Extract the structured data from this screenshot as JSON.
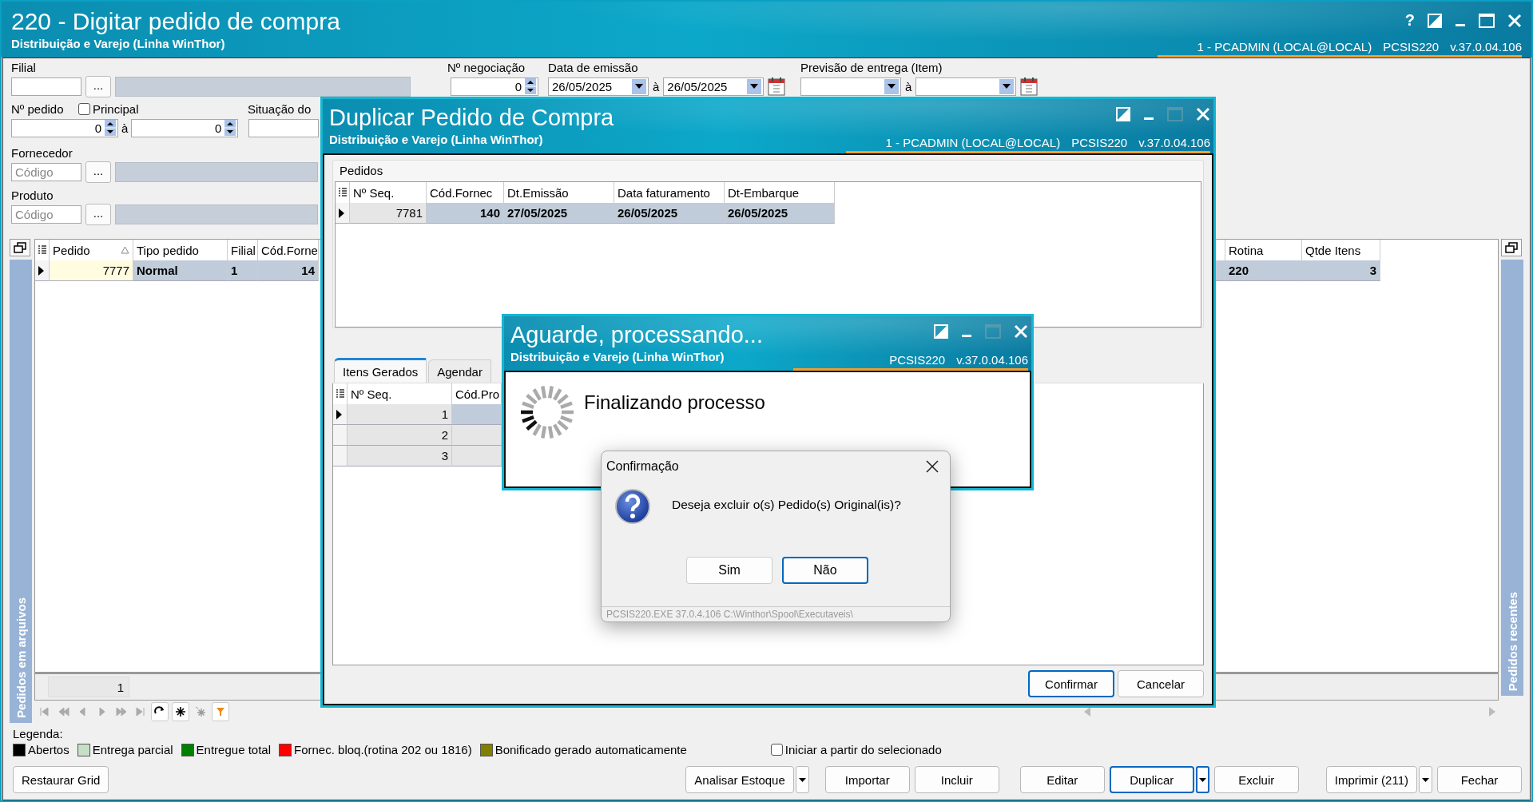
{
  "window": {
    "title": "220 - Digitar pedido de compra",
    "subtitle": "Distribuição e Varejo (Linha WinThor)",
    "help": "?",
    "session": "1 - PCADMIN (LOCAL@LOCAL)",
    "module": "PCSIS220",
    "version": "v.37.0.04.106"
  },
  "filters": {
    "filial": {
      "label": "Filial",
      "button": "..."
    },
    "negociacao": {
      "label": "Nº negociação",
      "value": "0"
    },
    "emissao": {
      "label": "Data de emissão",
      "from": "26/05/2025",
      "sep": "à",
      "to": "26/05/2025"
    },
    "previsao": {
      "label": "Previsão  de entrega (Item)",
      "sep": "à"
    },
    "pedido": {
      "label": "Nº pedido",
      "from": "0",
      "sep": "à",
      "to": "0"
    },
    "principal": {
      "label": "Principal",
      "checked": false
    },
    "situacao": {
      "label": "Situação do"
    },
    "fornecedor": {
      "label": "Fornecedor",
      "placeholder": "Código",
      "button": "..."
    },
    "produto": {
      "label": "Produto",
      "placeholder": "Código",
      "button": "..."
    }
  },
  "left_panel": "Pedidos em arquivos",
  "right_panel": "Pedidos recentes",
  "main_grid": {
    "columns": [
      {
        "label": "Pedido",
        "sorted": true
      },
      {
        "label": "Tipo pedido",
        "sorted": false
      },
      {
        "label": "Filial",
        "sorted": false
      },
      {
        "label": "Cód.Forne",
        "sorted": false
      },
      {
        "label": "Rotina",
        "sorted": false
      },
      {
        "label": "Qtde Itens",
        "sorted": false
      }
    ],
    "rows": [
      {
        "selected": true,
        "cells": [
          {
            "text": "7777",
            "focused": true
          },
          {
            "text": "Normal",
            "focused": false
          },
          {
            "text": "1",
            "focused": false
          },
          {
            "text": "14",
            "focused": false
          },
          {
            "text": "220",
            "focused": false
          },
          {
            "text": "3",
            "focused": false
          }
        ]
      }
    ],
    "count": "1"
  },
  "legend": {
    "title": "Legenda:",
    "items": [
      {
        "label": "Abertos",
        "color": "#000000"
      },
      {
        "label": "Entrega parcial",
        "color": "#c6e0c6"
      },
      {
        "label": "Entregue total",
        "color": "#008000"
      },
      {
        "label": "Fornec. bloq.(rotina 202 ou 1816)",
        "color": "#ff0000"
      },
      {
        "label": "Bonificado gerado automaticamente",
        "color": "#808000"
      }
    ]
  },
  "start_from_selected": {
    "label": "Iniciar a partir do selecionado",
    "checked": false
  },
  "buttons": [
    {
      "label": "Restaurar Grid",
      "dropdown": false,
      "focused": false
    },
    {
      "label": "Analisar Estoque",
      "dropdown": true,
      "focused": false
    },
    {
      "label": "Importar",
      "dropdown": false,
      "focused": false
    },
    {
      "label": "Incluir",
      "dropdown": false,
      "focused": false
    },
    {
      "label": "Editar",
      "dropdown": false,
      "focused": false
    },
    {
      "label": "Duplicar",
      "dropdown": true,
      "focused": true
    },
    {
      "label": "Excluir",
      "dropdown": false,
      "focused": false
    },
    {
      "label": "Imprimir (211)",
      "dropdown": true,
      "focused": false
    },
    {
      "label": "Fechar",
      "dropdown": false,
      "focused": false
    }
  ],
  "duplicate_dialog": {
    "title": "Duplicar Pedido de Compra",
    "subtitle": "Distribuição e Varejo (Linha WinThor)",
    "session": "1 - PCADMIN (LOCAL@LOCAL)",
    "module": "PCSIS220",
    "version": "v.37.0.04.106",
    "group": "Pedidos",
    "columns": [
      "Nº Seq.",
      "Cód.Fornec",
      "Dt.Emissão",
      "Data faturamento",
      "Dt-Embarque"
    ],
    "rows": [
      {
        "selected": true,
        "cells": [
          "7781",
          "140",
          "27/05/2025",
          "26/05/2025",
          "26/05/2025"
        ]
      }
    ],
    "tabs": [
      {
        "label": "Itens Gerados",
        "selected": true
      },
      {
        "label": "Agendar",
        "selected": false
      }
    ],
    "item_columns": [
      "Nº Seq.",
      "Cód.Pro"
    ],
    "item_rows": [
      {
        "selected": true,
        "cells": [
          "1"
        ]
      },
      {
        "selected": false,
        "cells": [
          "2"
        ]
      },
      {
        "selected": false,
        "cells": [
          "3"
        ]
      }
    ],
    "buttons": [
      {
        "label": "Confirmar",
        "focused": true
      },
      {
        "label": "Cancelar",
        "focused": false
      }
    ]
  },
  "progress_dialog": {
    "title": "Aguarde, processando...",
    "subtitle": "Distribuição e Varejo (Linha WinThor)",
    "module": "PCSIS220",
    "version": "v.37.0.04.106",
    "message": "Finalizando processo"
  },
  "confirm_dialog": {
    "title": "Confirmação",
    "message": "Deseja excluir o(s) Pedido(s) Original(is)?",
    "buttons": [
      {
        "label": "Sim",
        "focused": false
      },
      {
        "label": "Não",
        "focused": true
      }
    ],
    "footer": "PCSIS220.EXE 37.0.4.106 C:\\Winthor\\Spool\\Executaveis\\"
  }
}
